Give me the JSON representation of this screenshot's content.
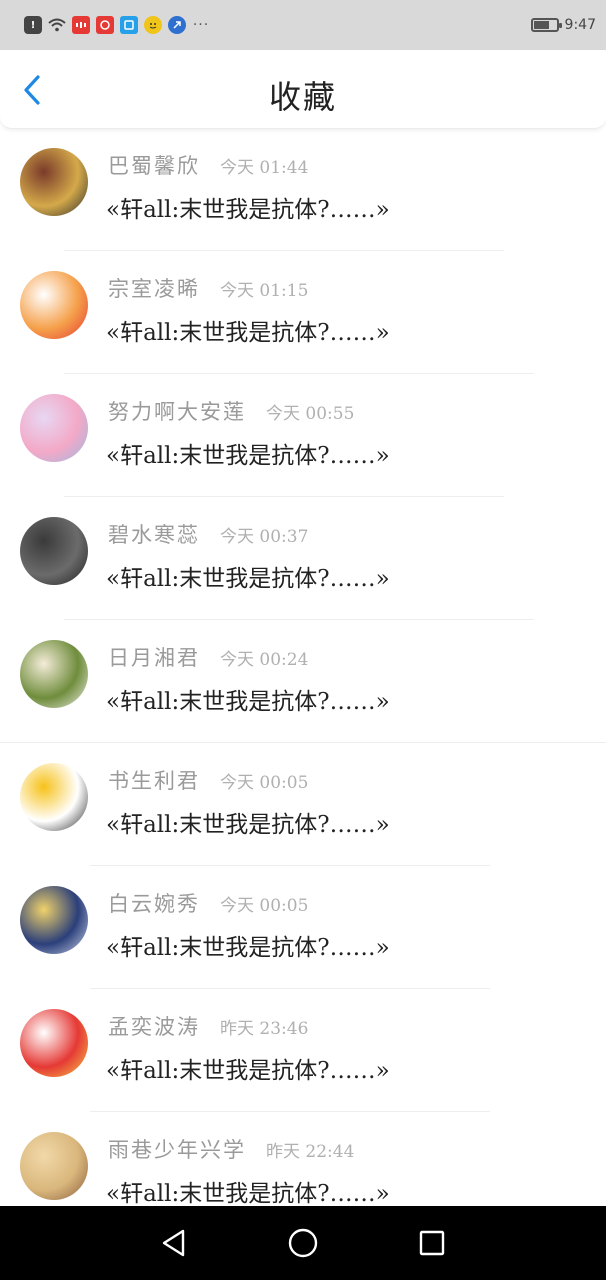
{
  "status_bar": {
    "time": "9:47",
    "battery_level": 0.7,
    "icons": [
      "alert-icon",
      "wifi-icon",
      "app-icon",
      "app-icon",
      "app-icon",
      "app-icon",
      "app-icon",
      "more-icon"
    ]
  },
  "header": {
    "title": "收藏",
    "back_icon": "chevron-left-icon",
    "accent_color": "#1e88e5"
  },
  "favorites": [
    {
      "name": "巴蜀馨欣",
      "time": "今天 01:44",
      "title": "«轩all:末世我是抗体?……»",
      "avatar_colors": [
        "#7a3b2a",
        "#d4a94a",
        "#2b2b2b"
      ]
    },
    {
      "name": "宗室凌晞",
      "time": "今天 01:15",
      "title": "«轩all:末世我是抗体?……»",
      "avatar_colors": [
        "#ffffff",
        "#f5a04a",
        "#e53935"
      ]
    },
    {
      "name": "努力啊大安莲",
      "time": "今天 00:55",
      "title": "«轩all:末世我是抗体?……»",
      "avatar_colors": [
        "#e7d7f2",
        "#f3a9c7",
        "#9bb7e0"
      ]
    },
    {
      "name": "碧水寒蕊",
      "time": "今天 00:37",
      "title": "«轩all:末世我是抗体?……»",
      "avatar_colors": [
        "#3a3a3a",
        "#6b6b6b",
        "#1f1f1f"
      ]
    },
    {
      "name": "日月湘君",
      "time": "今天 00:24",
      "title": "«轩all:末世我是抗体?……»",
      "avatar_colors": [
        "#f4ecd8",
        "#6f8d3c",
        "#f2f0ea"
      ]
    },
    {
      "name": "书生利君",
      "time": "今天 00:05",
      "title": "«轩all:末世我是抗体?……»",
      "avatar_colors": [
        "#f6c21a",
        "#ffffff",
        "#222222"
      ]
    },
    {
      "name": "白云婉秀",
      "time": "今天 00:05",
      "title": "«轩all:末世我是抗体?……»",
      "avatar_colors": [
        "#f0d26a",
        "#2b3f7a",
        "#cfd7ec"
      ]
    },
    {
      "name": "孟奕波涛",
      "time": "昨天 23:46",
      "title": "«轩all:末世我是抗体?……»",
      "avatar_colors": [
        "#ffffff",
        "#e53935",
        "#f7c948"
      ]
    },
    {
      "name": "雨巷少年兴学",
      "time": "昨天 22:44",
      "title": "«轩all:末世我是抗体?……»",
      "avatar_colors": [
        "#f2d8a9",
        "#d9b77c",
        "#8a5a3a"
      ]
    }
  ],
  "nav_bar": {
    "icons": [
      "back-triangle-icon",
      "home-circle-icon",
      "recents-square-icon"
    ]
  }
}
